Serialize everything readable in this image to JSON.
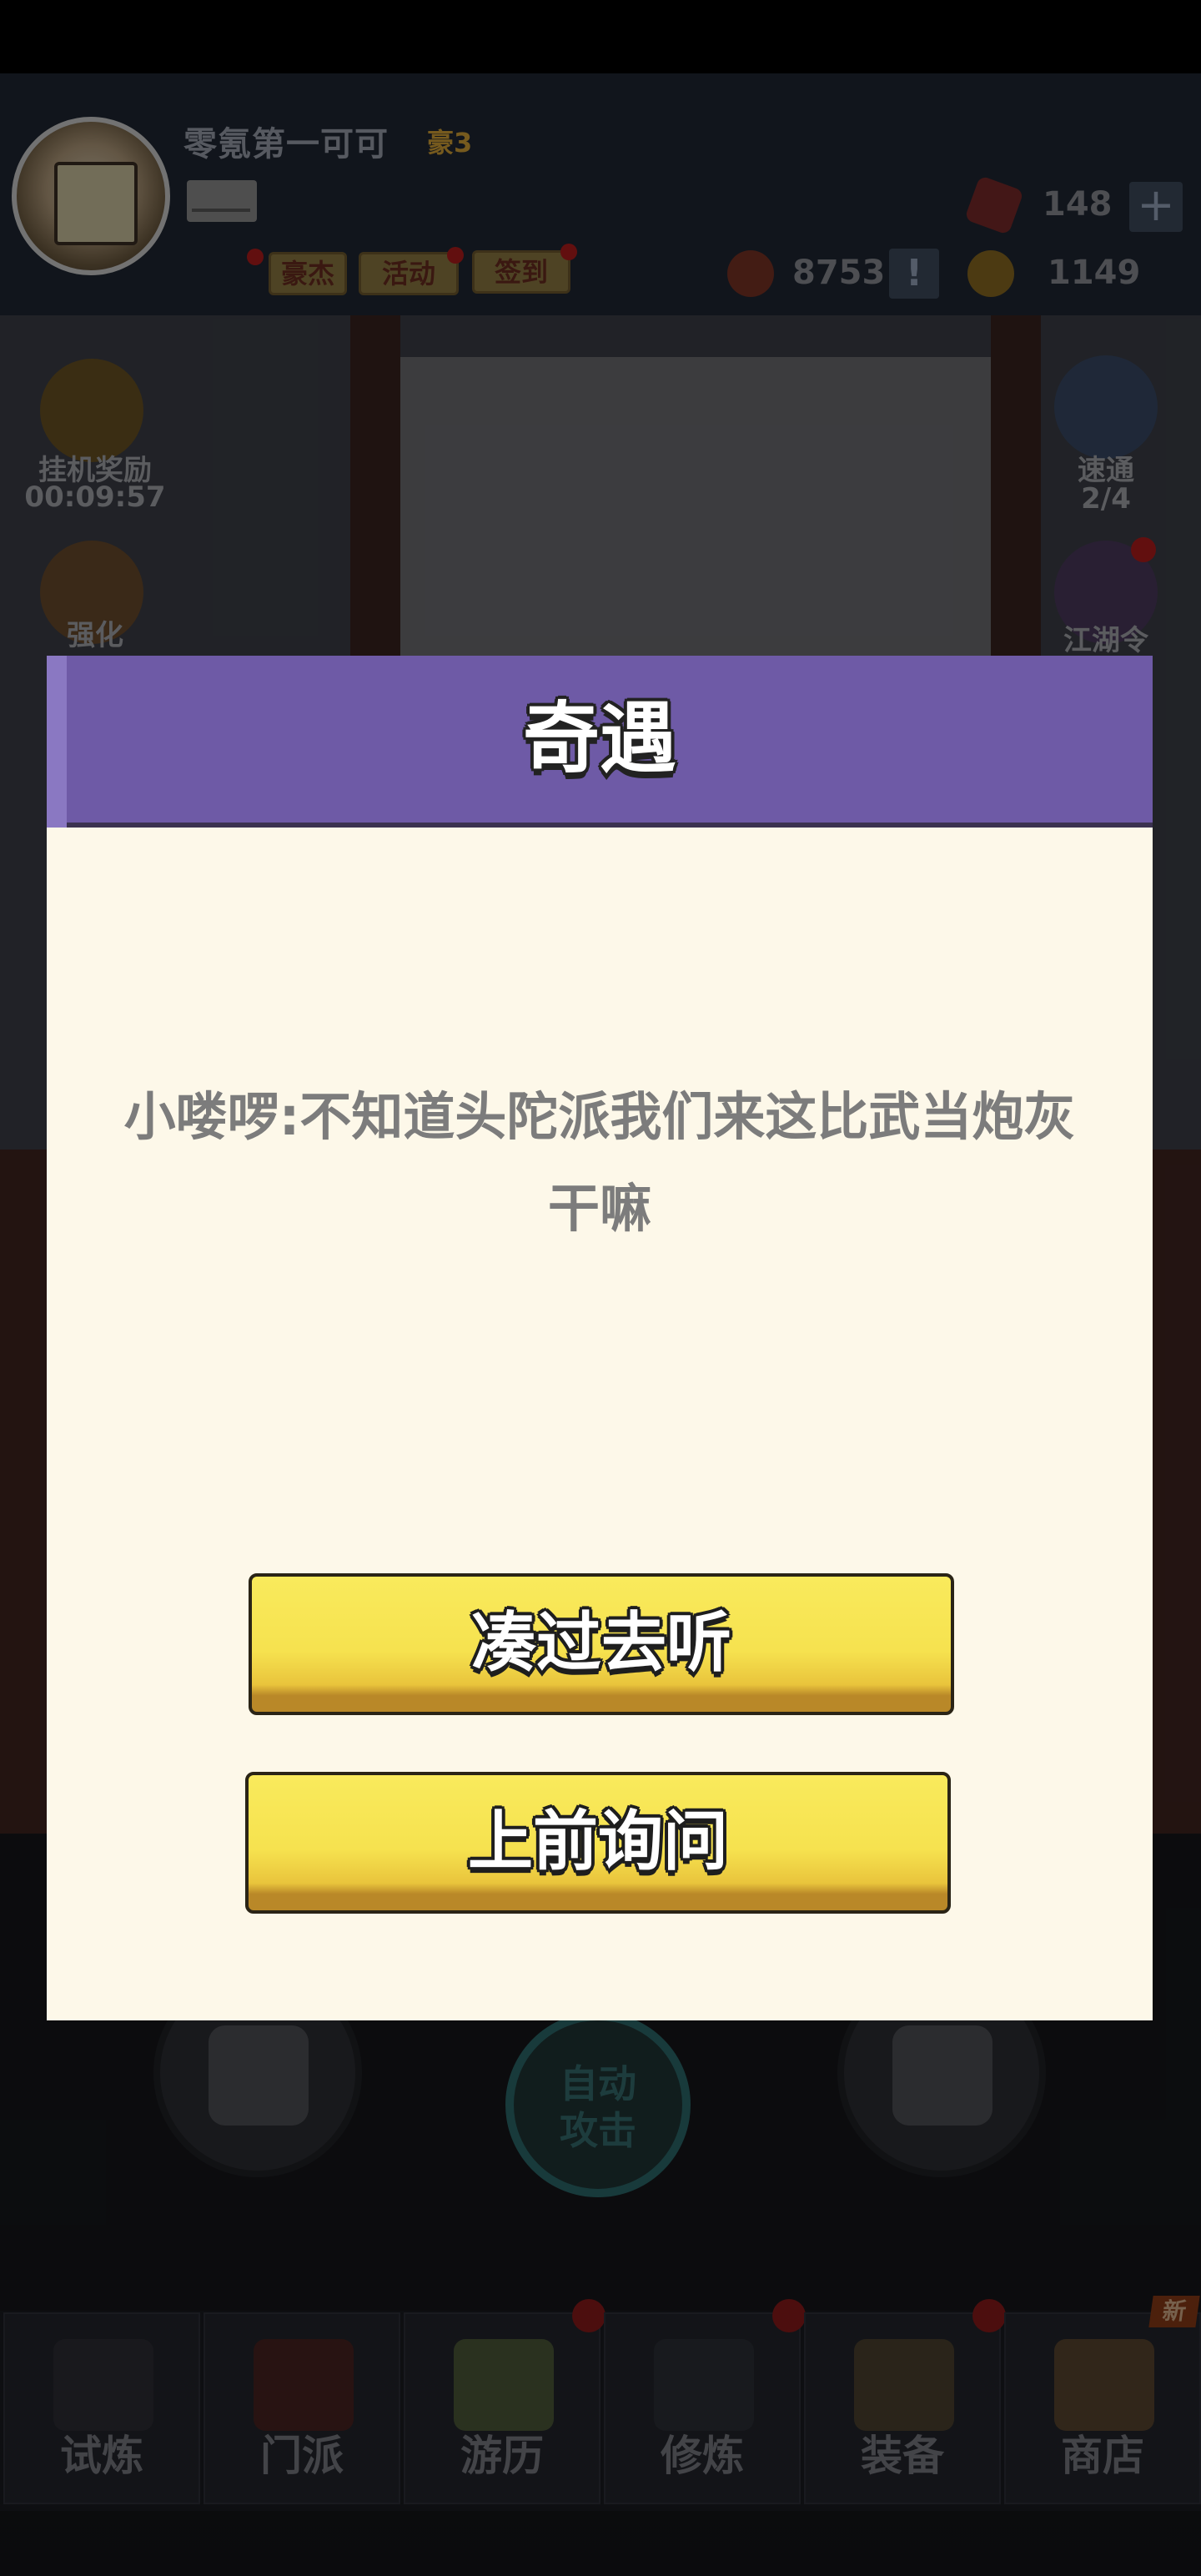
{
  "header": {
    "player_name": "零氪第一可可",
    "vip_level": "豪3",
    "buttons": {
      "hero": "豪杰",
      "event": "活动",
      "checkin": "签到"
    },
    "resources": {
      "gems": "148",
      "tokens": "8753",
      "coins": "1149"
    },
    "plus_symbol": "+",
    "alert_symbol": "!"
  },
  "side_left": {
    "idle_reward_label": "挂机奖励",
    "idle_timer": "00:09:57",
    "enhance_label": "强化"
  },
  "side_right": {
    "quick_pass_label": "速通",
    "quick_pass_count": "2/4",
    "jianghu_label": "江湖令"
  },
  "controls": {
    "auto_attack_line1": "自动",
    "auto_attack_line2": "攻击"
  },
  "bottom_nav": {
    "items": [
      {
        "label": "试炼"
      },
      {
        "label": "门派"
      },
      {
        "label": "游历"
      },
      {
        "label": "修炼"
      },
      {
        "label": "装备"
      },
      {
        "label": "商店"
      }
    ],
    "new_badge": "新"
  },
  "dialog": {
    "title": "奇遇",
    "message": "小喽啰:不知道头陀派我们来这比武当炮灰干嘛",
    "choice_1": "凑过去听",
    "choice_2": "上前询问"
  },
  "colors": {
    "dialog_header": "#6e5aa6",
    "dialog_body": "#fdf8e9",
    "choice_button": "#f6e24f"
  }
}
